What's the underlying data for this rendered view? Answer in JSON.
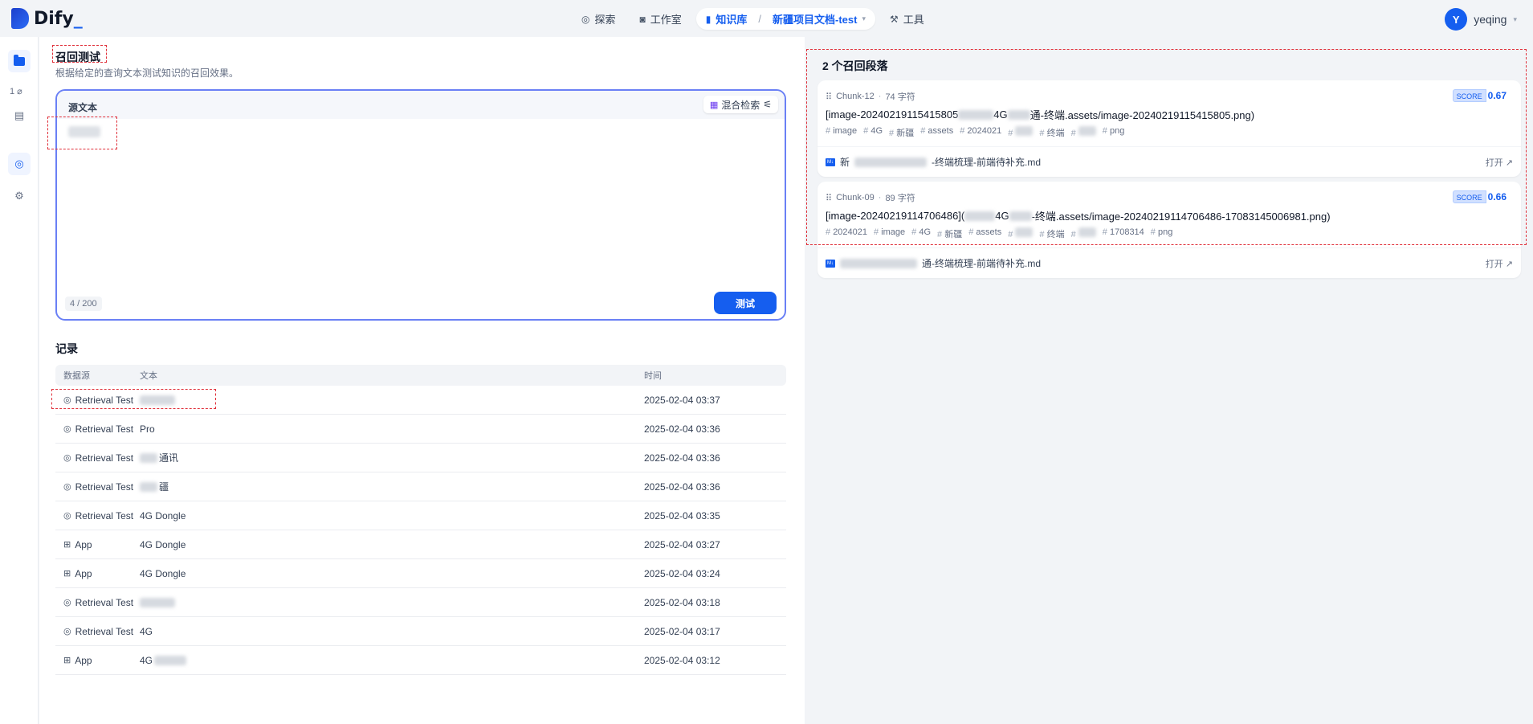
{
  "app": {
    "brand": "Dify",
    "brand_suffix": "_"
  },
  "nav": {
    "explore": "探索",
    "studio": "工作室",
    "knowledge": "知识库",
    "separator": "/",
    "dataset": "新疆项目文档-test",
    "tools": "工具"
  },
  "user": {
    "initial": "Y",
    "name": "yeqing"
  },
  "rail": {
    "doc_count": "1"
  },
  "page": {
    "title": "召回测试",
    "description": "根据给定的查询文本测试知识的召回效果。"
  },
  "query": {
    "label": "源文本",
    "mode": "混合检索",
    "count": "4 / 200",
    "button": "测试"
  },
  "records": {
    "title": "记录",
    "headers": {
      "source": "数据源",
      "text": "文本",
      "time": "时间"
    },
    "rows": [
      {
        "source": "Retrieval Test",
        "text": "",
        "time": "2025-02-04 03:37",
        "icon": "target-icon"
      },
      {
        "source": "Retrieval Test",
        "text": "Pro",
        "time": "2025-02-04 03:36",
        "icon": "target-icon"
      },
      {
        "source": "Retrieval Test",
        "text": "通讯",
        "time": "2025-02-04 03:36",
        "icon": "target-icon"
      },
      {
        "source": "Retrieval Test",
        "text": "疆",
        "time": "2025-02-04 03:36",
        "icon": "target-icon"
      },
      {
        "source": "Retrieval Test",
        "text": "4G Dongle",
        "time": "2025-02-04 03:35",
        "icon": "target-icon"
      },
      {
        "source": "App",
        "text": "4G Dongle",
        "time": "2025-02-04 03:27",
        "icon": "app-icon"
      },
      {
        "source": "App",
        "text": "4G Dongle",
        "time": "2025-02-04 03:24",
        "icon": "app-icon"
      },
      {
        "source": "Retrieval Test",
        "text": "",
        "time": "2025-02-04 03:18",
        "icon": "target-icon"
      },
      {
        "source": "Retrieval Test",
        "text": "4G",
        "time": "2025-02-04 03:17",
        "icon": "target-icon"
      },
      {
        "source": "App",
        "text": "4G",
        "time": "2025-02-04 03:12",
        "icon": "app-icon"
      }
    ]
  },
  "results": {
    "title": "2 个召回段落",
    "score_label": "SCORE",
    "open_label": "打开 ↗",
    "cards": [
      {
        "chunk": "Chunk-12",
        "chars": "74 字符",
        "score": "0.67",
        "content_a": "[image-20240219115415805",
        "content_b": "4G",
        "content_c": "通-终端.assets/image-20240219115415805.png)",
        "tags": [
          "image",
          "4G",
          "新疆",
          "assets",
          "2024021",
          "",
          "终端",
          "",
          "png"
        ],
        "file_a": "新",
        "file_b": "-终端梳理-前端待补充.md"
      },
      {
        "chunk": "Chunk-09",
        "chars": "89 字符",
        "score": "0.66",
        "content_a": "[image-20240219114706486](",
        "content_b": "4G",
        "content_c": "-终端.assets/image-20240219114706486-17083145006981.png)",
        "tags": [
          "2024021",
          "image",
          "4G",
          "新疆",
          "assets",
          "",
          "终端",
          "",
          "1708314",
          "png"
        ],
        "file_a": "",
        "file_b": "通-终端梳理-前端待补充.md"
      }
    ]
  }
}
